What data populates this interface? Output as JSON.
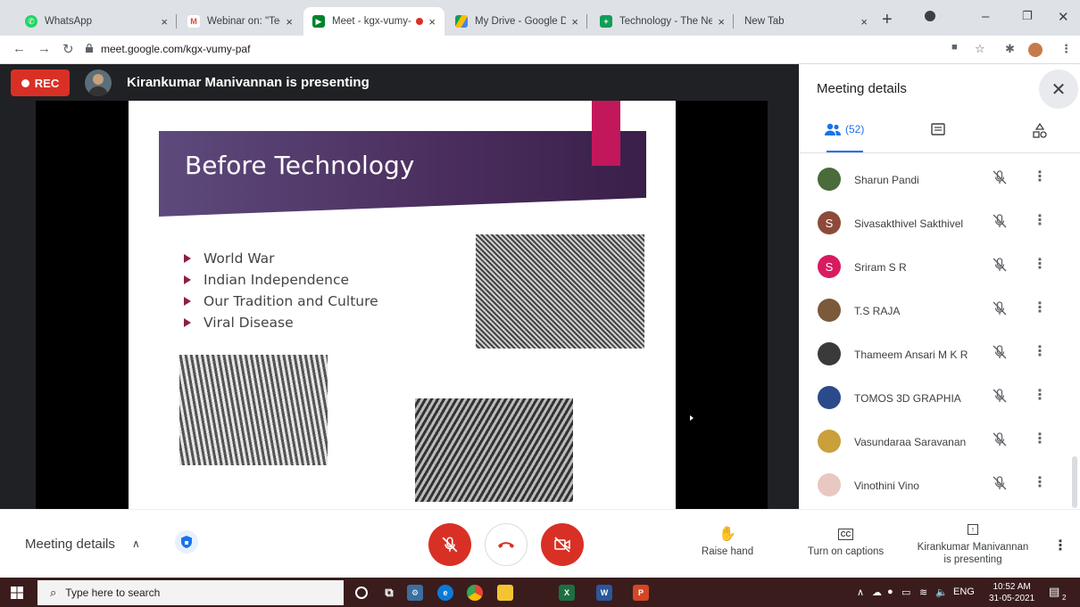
{
  "browser": {
    "tabs": [
      {
        "title": "WhatsApp",
        "close": "×",
        "favicon": "whatsapp-icon",
        "color": "#25d366"
      },
      {
        "title": "Webinar on: \"Technol",
        "close": "×",
        "favicon": "gmail-icon",
        "color": "#ea4335"
      },
      {
        "title": "Meet - kgx-vumy-",
        "close": "×",
        "favicon": "meet-icon",
        "color": "#00832d",
        "active": true
      },
      {
        "title": "My Drive - Google Dri",
        "close": "×",
        "favicon": "drive-icon",
        "color": "#fbbc04"
      },
      {
        "title": "Technology - The New",
        "close": "×",
        "favicon": "newspaper-icon",
        "color": "#0f9d58"
      },
      {
        "title": "New Tab",
        "close": "×",
        "favicon": "",
        "color": ""
      }
    ],
    "url": "meet.google.com/kgx-vumy-paf"
  },
  "stage": {
    "rec_label": "REC",
    "presenting_text": "Kirankumar Manivannan is presenting"
  },
  "slide": {
    "title": "Before Technology",
    "bullets": [
      "World War",
      "Indian Independence",
      "Our Tradition and Culture",
      "Viral Disease"
    ]
  },
  "panel": {
    "title": "Meeting details",
    "people_count": "(52)",
    "people": [
      {
        "name": "Sharun Pandi",
        "initial": "",
        "avatar_color": "#4a6b3a"
      },
      {
        "name": "Sivasakthivel Sakthivel",
        "initial": "S",
        "avatar_color": "#8d4a3b"
      },
      {
        "name": "Sriram S R",
        "initial": "S",
        "avatar_color": "#d81b60"
      },
      {
        "name": "T.S RAJA",
        "initial": "",
        "avatar_color": "#7a5a3a"
      },
      {
        "name": "Thameem Ansari M K R",
        "initial": "",
        "avatar_color": "#3a3a3a"
      },
      {
        "name": "TOMOS 3D GRAPHIA",
        "initial": "",
        "avatar_color": "#2a4a8a"
      },
      {
        "name": "Vasundaraa Saravanan",
        "initial": "",
        "avatar_color": "#c9a03a"
      },
      {
        "name": "Vinothini Vino",
        "initial": "",
        "avatar_color": "#e8c8c0"
      }
    ]
  },
  "bottom": {
    "meeting_details": "Meeting details",
    "raise_hand": "Raise hand",
    "captions": "Turn on captions",
    "presenting_line1": "Kirankumar Manivannan",
    "presenting_line2": "is presenting"
  },
  "taskbar": {
    "search_placeholder": "Type here to search",
    "lang": "ENG",
    "time": "10:52 AM",
    "date": "31-05-2021",
    "notifications": "2"
  },
  "colors": {
    "accent": "#1a73e8",
    "danger": "#d93025"
  }
}
